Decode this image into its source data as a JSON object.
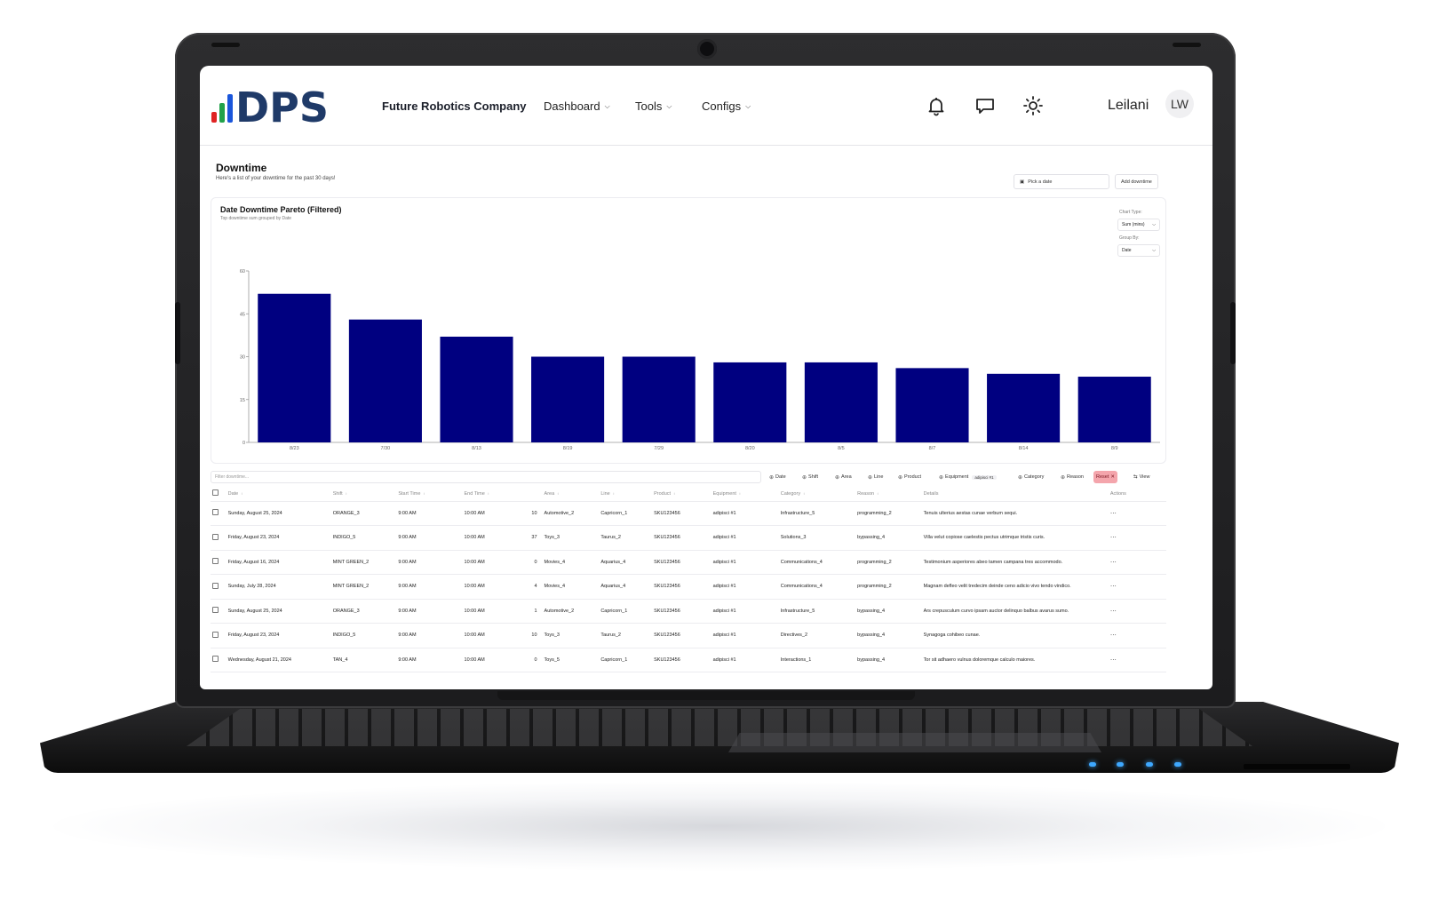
{
  "header": {
    "logo_text": "DPS",
    "company": "Future Robotics Company",
    "nav": [
      {
        "label": "Dashboard"
      },
      {
        "label": "Tools"
      },
      {
        "label": "Configs"
      }
    ],
    "icons": [
      "bell-icon",
      "message-icon",
      "sun-icon"
    ],
    "username": "Leilani",
    "avatar_initials": "LW"
  },
  "page": {
    "title": "Downtime",
    "subtitle": "Here's a list of your downtime for the past 30 days!",
    "pick_date": "Pick a date",
    "add_downtime": "Add downtime"
  },
  "chart_controls": {
    "chart_type_label": "Chart Type:",
    "chart_type_value": "Sum (mins)",
    "group_by_label": "Group By:",
    "group_by_value": "Date"
  },
  "chart_data": {
    "type": "bar",
    "title": "Date Downtime Pareto (Filtered)",
    "subtitle": "Top downtime sum grouped by Date",
    "categories": [
      "8/23",
      "7/30",
      "8/13",
      "8/19",
      "7/29",
      "8/20",
      "8/5",
      "8/7",
      "8/14",
      "8/9"
    ],
    "values": [
      52,
      43,
      37,
      30,
      30,
      28,
      28,
      26,
      24,
      23
    ],
    "yticks": [
      0,
      15,
      30,
      45,
      60
    ],
    "ylim": [
      0,
      60
    ],
    "bar_color": "#000080",
    "grid": false
  },
  "filters": {
    "placeholder": "Filter downtime...",
    "chips": [
      "Date",
      "Shift",
      "Area",
      "Line",
      "Product",
      "Equipment",
      "Category",
      "Reason"
    ],
    "equipment_tag": "adipisci #1",
    "reset": "Reset",
    "view": "View"
  },
  "table": {
    "columns": [
      "Date",
      "Shift",
      "Start Time",
      "End Time",
      "Area",
      "Line",
      "Product",
      "Equipment",
      "Category",
      "Reason",
      "Details",
      "Actions"
    ],
    "rows": [
      {
        "date": "Sunday, August 25, 2024",
        "shift": "ORANGE_3",
        "start": "9:00 AM",
        "end": "10:00 AM",
        "dur": "10",
        "area": "Automotive_2",
        "line": "Capricorn_1",
        "product": "SKU123456",
        "equipment": "adipisci #1",
        "category": "Infrastructure_5",
        "reason": "programming_2",
        "details": "Tenuis ulterius aestas cunae verbum sequi."
      },
      {
        "date": "Friday, August 23, 2024",
        "shift": "INDIGO_5",
        "start": "9:00 AM",
        "end": "10:00 AM",
        "dur": "37",
        "area": "Toys_3",
        "line": "Taurus_2",
        "product": "SKU123456",
        "equipment": "adipisci #1",
        "category": "Solutions_3",
        "reason": "bypassing_4",
        "details": "Villa velut copiose caelestis pectus utrimque tristis curis."
      },
      {
        "date": "Friday, August 16, 2024",
        "shift": "MINT GREEN_2",
        "start": "9:00 AM",
        "end": "10:00 AM",
        "dur": "0",
        "area": "Movies_4",
        "line": "Aquarius_4",
        "product": "SKU123456",
        "equipment": "adipisci #1",
        "category": "Communications_4",
        "reason": "programming_2",
        "details": "Testimonium asperiores abeo tamen campana tres accommodo."
      },
      {
        "date": "Sunday, July 28, 2024",
        "shift": "MINT GREEN_2",
        "start": "9:00 AM",
        "end": "10:00 AM",
        "dur": "4",
        "area": "Movies_4",
        "line": "Aquarius_4",
        "product": "SKU123456",
        "equipment": "adipisci #1",
        "category": "Communications_4",
        "reason": "programming_2",
        "details": "Magnam defleo velit tredecim deinde ceno adicio vivo tendo vindico."
      },
      {
        "date": "Sunday, August 25, 2024",
        "shift": "ORANGE_3",
        "start": "9:00 AM",
        "end": "10:00 AM",
        "dur": "1",
        "area": "Automotive_2",
        "line": "Capricorn_1",
        "product": "SKU123456",
        "equipment": "adipisci #1",
        "category": "Infrastructure_5",
        "reason": "bypassing_4",
        "details": "Ars crepusculum curvo ipsam auctor delinquo balbus avarus sumo."
      },
      {
        "date": "Friday, August 23, 2024",
        "shift": "INDIGO_5",
        "start": "9:00 AM",
        "end": "10:00 AM",
        "dur": "10",
        "area": "Toys_3",
        "line": "Taurus_2",
        "product": "SKU123456",
        "equipment": "adipisci #1",
        "category": "Directives_2",
        "reason": "bypassing_4",
        "details": "Synagoga cohibeo cunae."
      },
      {
        "date": "Wednesday, August 21, 2024",
        "shift": "TAN_4",
        "start": "9:00 AM",
        "end": "10:00 AM",
        "dur": "0",
        "area": "Toys_5",
        "line": "Capricorn_1",
        "product": "SKU123456",
        "equipment": "adipisci #1",
        "category": "Interactions_1",
        "reason": "bypassing_4",
        "details": "Tor sit adhaero vulnus doloremque calculo maiores."
      }
    ]
  }
}
